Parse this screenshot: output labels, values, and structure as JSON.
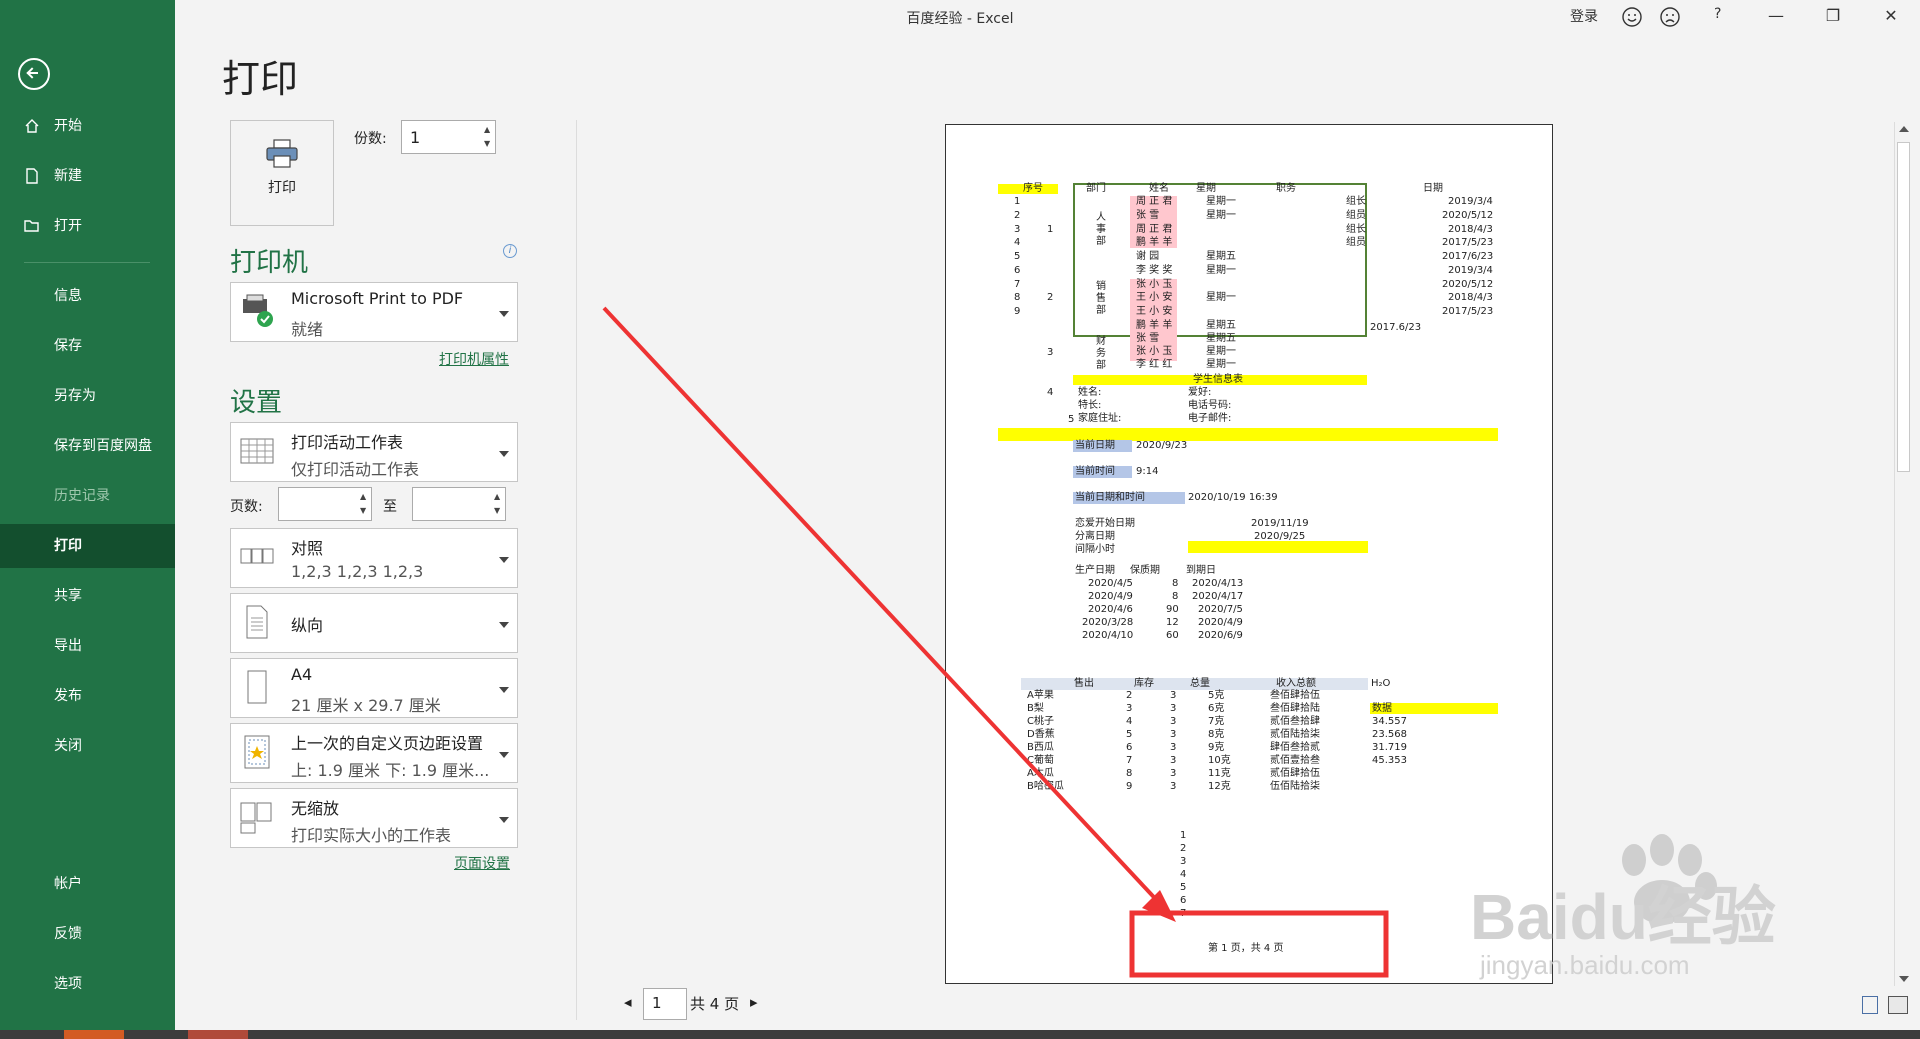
{
  "window": {
    "title": "百度经验 - Excel",
    "login": "登录",
    "help": "?",
    "controls": [
      "—",
      "❐",
      "✕"
    ]
  },
  "sidebar": {
    "items": [
      {
        "label": "开始",
        "icon": "home-icon"
      },
      {
        "label": "新建",
        "icon": "new-document-icon"
      },
      {
        "label": "打开",
        "icon": "open-folder-icon"
      },
      {
        "label": "信息"
      },
      {
        "label": "保存"
      },
      {
        "label": "另存为"
      },
      {
        "label": "保存到百度网盘"
      },
      {
        "label": "历史记录"
      },
      {
        "label": "打印"
      },
      {
        "label": "共享"
      },
      {
        "label": "导出"
      },
      {
        "label": "发布"
      },
      {
        "label": "关闭"
      },
      {
        "label": "帐户"
      },
      {
        "label": "反馈"
      },
      {
        "label": "选项"
      }
    ],
    "active": "打印",
    "colors": {
      "background": "#217346",
      "active": "#134f2e"
    }
  },
  "print": {
    "page_title": "打印",
    "print_button": "打印",
    "copies_label": "份数:",
    "copies_value": "1",
    "printer_section": "打印机",
    "printer_name": "Microsoft Print to PDF",
    "printer_status": "就绪",
    "printer_properties": "打印机属性",
    "settings_section": "设置",
    "what_main": "打印活动工作表",
    "what_sub": "仅打印活动工作表",
    "pages_label": "页数:",
    "to_label": "至",
    "collate_main": "对照",
    "collate_sub": "1,2,3    1,2,3    1,2,3",
    "orientation": "纵向",
    "paper_main": "A4",
    "paper_sub": "21 厘米 x 29.7 厘米",
    "margins_main": "上一次的自定义页边距设置",
    "margins_sub": "上: 1.9 厘米 下: 1.9 厘米...",
    "scaling_main": "无缩放",
    "scaling_sub": "打印实际大小的工作表",
    "page_setup": "页面设置"
  },
  "pager": {
    "current": "1",
    "total": "共 4 页"
  },
  "preview": {
    "header_seq": "序号",
    "header_dept": "部门",
    "header_name": "姓名",
    "header_week": "星期",
    "header_role": "职务",
    "header_date": "日期",
    "seq": [
      "1",
      "2",
      "3",
      "4",
      "5",
      "6",
      "7",
      "8",
      "9"
    ],
    "groups": [
      "1",
      "2",
      "3",
      "4",
      "5"
    ],
    "dept1": "人\n事\n部",
    "dept2": "销\n售\n部",
    "dept3": "财\n务\n部",
    "names": [
      "周 正 君",
      "张    雪",
      "周 正 君",
      "鹏 羊 羊",
      "谢    园",
      "李 奖 奖",
      "张 小 玉",
      "王 小 安",
      "王 小 安",
      "鹏 羊 羊",
      "张    雪",
      "张 小 玉",
      "李 红 红"
    ],
    "weeks": [
      "星期一",
      "星期一",
      "",
      "",
      "星期五",
      "星期一",
      "",
      "星期一",
      "",
      "星期五",
      "星期五",
      "星期一",
      "星期一"
    ],
    "roles": [
      "组长",
      "组员",
      "组长",
      "组员"
    ],
    "dates": [
      "2019/3/4",
      "2020/5/12",
      "2018/4/3",
      "2017/5/23",
      "2017/6/23",
      "2019/3/4",
      "2020/5/12",
      "2018/4/3",
      "2017/5/23"
    ],
    "extra_date": "2017.6/23",
    "student_title": "学生信息表",
    "student_fields": [
      "姓名:",
      "爱好:",
      "特长:",
      "电话号码:",
      "家庭住址:",
      "电子邮件:"
    ],
    "cur_date_label": "当前日期",
    "cur_date": "2020/9/23",
    "cur_time_label": "当前时间",
    "cur_time": "9:14",
    "cur_dt_label": "当前日期和时间",
    "cur_dt": "2020/10/19 16:39",
    "love_start_label": "恋爱开始日期",
    "love_start": "2019/11/19",
    "breakup_label": "分离日期",
    "breakup": "2020/9/25",
    "interval_label": "间隔小时",
    "prod_headers": [
      "生产日期",
      "保质期",
      "到期日"
    ],
    "prod_rows": [
      [
        "2020/4/5",
        "8",
        "2020/4/13"
      ],
      [
        "2020/4/9",
        "8",
        "2020/4/17"
      ],
      [
        "2020/4/6",
        "90",
        "2020/7/5"
      ],
      [
        "2020/3/28",
        "12",
        "2020/4/9"
      ],
      [
        "2020/4/10",
        "60",
        "2020/6/9"
      ]
    ],
    "sales_headers": [
      "售出",
      "库存",
      "总量",
      "收入总额"
    ],
    "h2o": "H₂O",
    "sales_rows": [
      [
        "A苹果",
        "2",
        "3",
        "5克",
        "叁佰肆拾伍"
      ],
      [
        "B梨",
        "3",
        "3",
        "6克",
        "叁佰肆拾陆"
      ],
      [
        "C桃子",
        "4",
        "3",
        "7克",
        "贰佰叁拾肆"
      ],
      [
        "D香蕉",
        "5",
        "3",
        "8克",
        "贰佰陆拾柒"
      ],
      [
        "B西瓜",
        "6",
        "3",
        "9克",
        "肆佰叁拾贰"
      ],
      [
        "C葡萄",
        "7",
        "3",
        "10克",
        "贰佰壹拾叁"
      ],
      [
        "A木瓜",
        "8",
        "3",
        "11克",
        "贰佰肆拾伍"
      ],
      [
        "B哈密瓜",
        "9",
        "3",
        "12克",
        "伍佰陆拾柒"
      ]
    ],
    "data_label": "数据",
    "numbers": [
      "34.557",
      "23.568",
      "31.719",
      "45.353"
    ],
    "list_nums": [
      "1",
      "2",
      "3",
      "4",
      "5",
      "6",
      "7"
    ],
    "footer": "第 1 页，共 4 页"
  },
  "watermark": {
    "brand": "Baidu经验",
    "url": "jingyan.baidu.com"
  },
  "annotation": {
    "color": "#ee3333"
  }
}
